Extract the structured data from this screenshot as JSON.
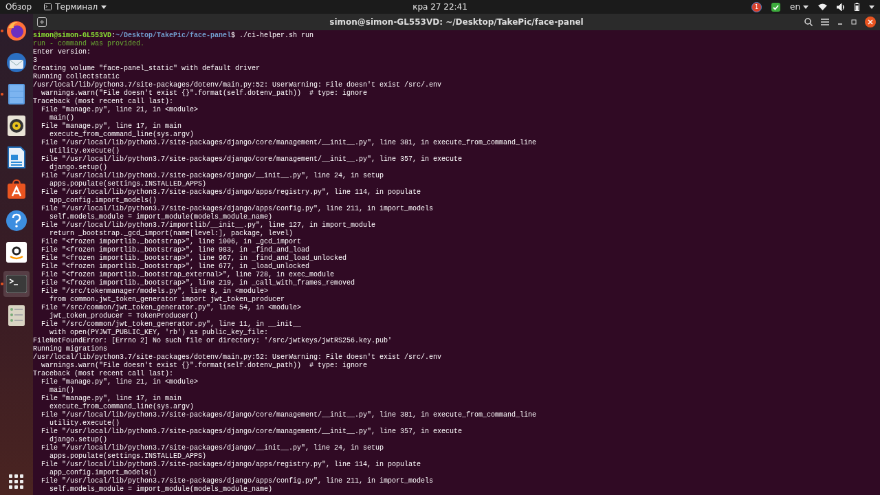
{
  "top_bar": {
    "activities": "Обзор",
    "app_menu": "Терминал",
    "clock": "кра 27  22:41",
    "keyboard_layout": "en",
    "notification_count": "1"
  },
  "dock": {
    "items": [
      {
        "kind": "browser",
        "running": true,
        "selected": false
      },
      {
        "kind": "mail",
        "running": false,
        "selected": false
      },
      {
        "kind": "files",
        "running": true,
        "selected": false
      },
      {
        "kind": "music",
        "running": false,
        "selected": false
      },
      {
        "kind": "document",
        "running": false,
        "selected": false
      },
      {
        "kind": "store",
        "running": false,
        "selected": false
      },
      {
        "kind": "help",
        "running": false,
        "selected": false
      },
      {
        "kind": "shop",
        "running": false,
        "selected": false
      },
      {
        "kind": "terminal",
        "running": true,
        "selected": true
      },
      {
        "kind": "storage",
        "running": false,
        "selected": false
      }
    ]
  },
  "window": {
    "title": "simon@simon-GL553VD: ~/Desktop/TakePic/face-panel"
  },
  "terminal": {
    "lines": [
      {
        "kind": "prompt",
        "user": "simon@simon-GL553VD",
        "separator": ":",
        "path": "~/Desktop/TakePic/face-panel",
        "command": "$ ./ci-helper.sh run"
      },
      {
        "kind": "info",
        "text": "run - command was provided."
      },
      {
        "kind": "output",
        "text": "Enter version:"
      },
      {
        "kind": "output",
        "text": "3"
      },
      {
        "kind": "output",
        "text": "Creating volume \"face-panel_static\" with default driver"
      },
      {
        "kind": "output",
        "text": "Running collectstatic"
      },
      {
        "kind": "output",
        "text": "/usr/local/lib/python3.7/site-packages/dotenv/main.py:52: UserWarning: File doesn't exist /src/.env"
      },
      {
        "kind": "output",
        "text": "  warnings.warn(\"File doesn't exist {}\".format(self.dotenv_path))  # type: ignore"
      },
      {
        "kind": "output",
        "text": "Traceback (most recent call last):"
      },
      {
        "kind": "output",
        "text": "  File \"manage.py\", line 21, in <module>"
      },
      {
        "kind": "output",
        "text": "    main()"
      },
      {
        "kind": "output",
        "text": "  File \"manage.py\", line 17, in main"
      },
      {
        "kind": "output",
        "text": "    execute_from_command_line(sys.argv)"
      },
      {
        "kind": "output",
        "text": "  File \"/usr/local/lib/python3.7/site-packages/django/core/management/__init__.py\", line 381, in execute_from_command_line"
      },
      {
        "kind": "output",
        "text": "    utility.execute()"
      },
      {
        "kind": "output",
        "text": "  File \"/usr/local/lib/python3.7/site-packages/django/core/management/__init__.py\", line 357, in execute"
      },
      {
        "kind": "output",
        "text": "    django.setup()"
      },
      {
        "kind": "output",
        "text": "  File \"/usr/local/lib/python3.7/site-packages/django/__init__.py\", line 24, in setup"
      },
      {
        "kind": "output",
        "text": "    apps.populate(settings.INSTALLED_APPS)"
      },
      {
        "kind": "output",
        "text": "  File \"/usr/local/lib/python3.7/site-packages/django/apps/registry.py\", line 114, in populate"
      },
      {
        "kind": "output",
        "text": "    app_config.import_models()"
      },
      {
        "kind": "output",
        "text": "  File \"/usr/local/lib/python3.7/site-packages/django/apps/config.py\", line 211, in import_models"
      },
      {
        "kind": "output",
        "text": "    self.models_module = import_module(models_module_name)"
      },
      {
        "kind": "output",
        "text": "  File \"/usr/local/lib/python3.7/importlib/__init__.py\", line 127, in import_module"
      },
      {
        "kind": "output",
        "text": "    return _bootstrap._gcd_import(name[level:], package, level)"
      },
      {
        "kind": "output",
        "text": "  File \"<frozen importlib._bootstrap>\", line 1006, in _gcd_import"
      },
      {
        "kind": "output",
        "text": "  File \"<frozen importlib._bootstrap>\", line 983, in _find_and_load"
      },
      {
        "kind": "output",
        "text": "  File \"<frozen importlib._bootstrap>\", line 967, in _find_and_load_unlocked"
      },
      {
        "kind": "output",
        "text": "  File \"<frozen importlib._bootstrap>\", line 677, in _load_unlocked"
      },
      {
        "kind": "output",
        "text": "  File \"<frozen importlib._bootstrap_external>\", line 728, in exec_module"
      },
      {
        "kind": "output",
        "text": "  File \"<frozen importlib._bootstrap>\", line 219, in _call_with_frames_removed"
      },
      {
        "kind": "output",
        "text": "  File \"/src/tokenmanager/models.py\", line 8, in <module>"
      },
      {
        "kind": "output",
        "text": "    from common.jwt_token_generator import jwt_token_producer"
      },
      {
        "kind": "output",
        "text": "  File \"/src/common/jwt_token_generator.py\", line 54, in <module>"
      },
      {
        "kind": "output",
        "text": "    jwt_token_producer = TokenProducer()"
      },
      {
        "kind": "output",
        "text": "  File \"/src/common/jwt_token_generator.py\", line 11, in __init__"
      },
      {
        "kind": "output",
        "text": "    with open(PYJWT_PUBLIC_KEY, 'rb') as public_key_file:"
      },
      {
        "kind": "output",
        "text": "FileNotFoundError: [Errno 2] No such file or directory: '/src/jwtkeys/jwtRS256.key.pub'"
      },
      {
        "kind": "output",
        "text": "Running migrations"
      },
      {
        "kind": "output",
        "text": "/usr/local/lib/python3.7/site-packages/dotenv/main.py:52: UserWarning: File doesn't exist /src/.env"
      },
      {
        "kind": "output",
        "text": "  warnings.warn(\"File doesn't exist {}\".format(self.dotenv_path))  # type: ignore"
      },
      {
        "kind": "output",
        "text": "Traceback (most recent call last):"
      },
      {
        "kind": "output",
        "text": "  File \"manage.py\", line 21, in <module>"
      },
      {
        "kind": "output",
        "text": "    main()"
      },
      {
        "kind": "output",
        "text": "  File \"manage.py\", line 17, in main"
      },
      {
        "kind": "output",
        "text": "    execute_from_command_line(sys.argv)"
      },
      {
        "kind": "output",
        "text": "  File \"/usr/local/lib/python3.7/site-packages/django/core/management/__init__.py\", line 381, in execute_from_command_line"
      },
      {
        "kind": "output",
        "text": "    utility.execute()"
      },
      {
        "kind": "output",
        "text": "  File \"/usr/local/lib/python3.7/site-packages/django/core/management/__init__.py\", line 357, in execute"
      },
      {
        "kind": "output",
        "text": "    django.setup()"
      },
      {
        "kind": "output",
        "text": "  File \"/usr/local/lib/python3.7/site-packages/django/__init__.py\", line 24, in setup"
      },
      {
        "kind": "output",
        "text": "    apps.populate(settings.INSTALLED_APPS)"
      },
      {
        "kind": "output",
        "text": "  File \"/usr/local/lib/python3.7/site-packages/django/apps/registry.py\", line 114, in populate"
      },
      {
        "kind": "output",
        "text": "    app_config.import_models()"
      },
      {
        "kind": "output",
        "text": "  File \"/usr/local/lib/python3.7/site-packages/django/apps/config.py\", line 211, in import_models"
      },
      {
        "kind": "output",
        "text": "    self.models_module = import_module(models_module_name)"
      }
    ]
  }
}
